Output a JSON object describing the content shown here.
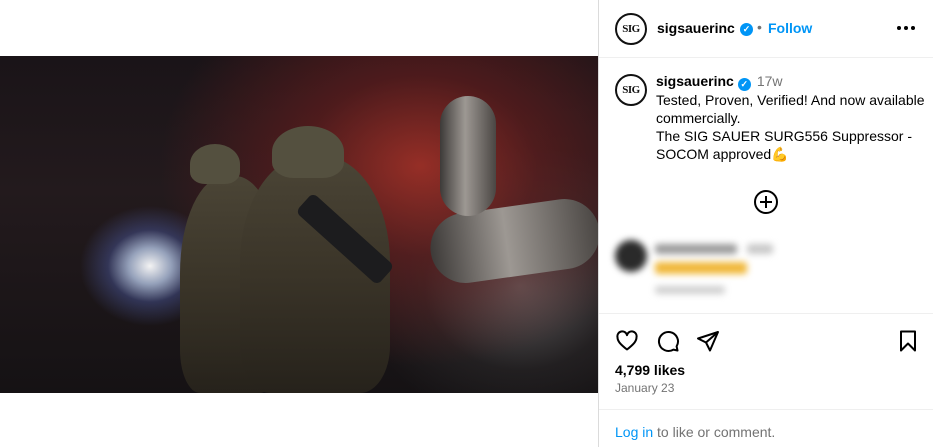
{
  "post": {
    "username": "sigsauerinc",
    "avatar_text": "SIG",
    "follow_label": "Follow",
    "separator": "•",
    "caption": {
      "time": "17w",
      "text": "Tested, Proven, Verified! And now available commercially.\nThe SIG SAUER SURG556 Suppressor - SOCOM approved💪"
    },
    "likes": "4,799 likes",
    "date": "January 23",
    "login_link": "Log in",
    "login_suffix": " to like or comment."
  },
  "icons": {
    "verified": "verified-badge-icon",
    "more": "more-options-icon",
    "add_comment": "add-circle-icon",
    "like": "heart-icon",
    "comment": "comment-icon",
    "share": "share-icon",
    "save": "bookmark-icon"
  },
  "colors": {
    "accent": "#0095f6",
    "muted_text": "#737373",
    "border": "#dbdbdb"
  }
}
